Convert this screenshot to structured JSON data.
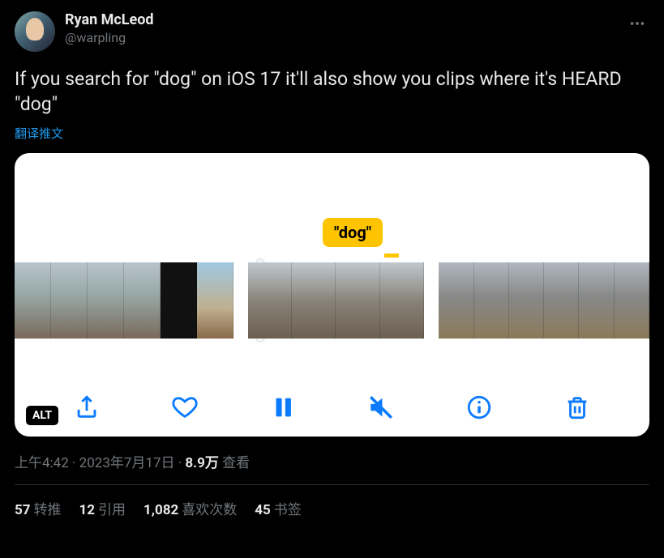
{
  "author": {
    "display_name": "Ryan McLeod",
    "handle": "@warpling"
  },
  "tweet_text": "If you search for \"dog\" on iOS 17 it'll also show you clips where it's HEARD \"dog\"",
  "translate_label": "翻译推文",
  "media": {
    "tooltip_text": "\"dog\"",
    "alt_badge": "ALT",
    "toolbar": {
      "share": "share-icon",
      "like": "heart-icon",
      "pause": "pause-icon",
      "mute": "mute-icon",
      "info": "info-icon",
      "trash": "trash-icon"
    }
  },
  "meta": {
    "time": "上午4:42",
    "dot1": " · ",
    "date": "2023年7月17日",
    "dot2": " · ",
    "views_count": "8.9万",
    "views_label": " 查看"
  },
  "stats": {
    "retweets_count": "57",
    "retweets_label": "转推",
    "quotes_count": "12",
    "quotes_label": "引用",
    "likes_count": "1,082",
    "likes_label": "喜欢次数",
    "bookmarks_count": "45",
    "bookmarks_label": "书签"
  }
}
